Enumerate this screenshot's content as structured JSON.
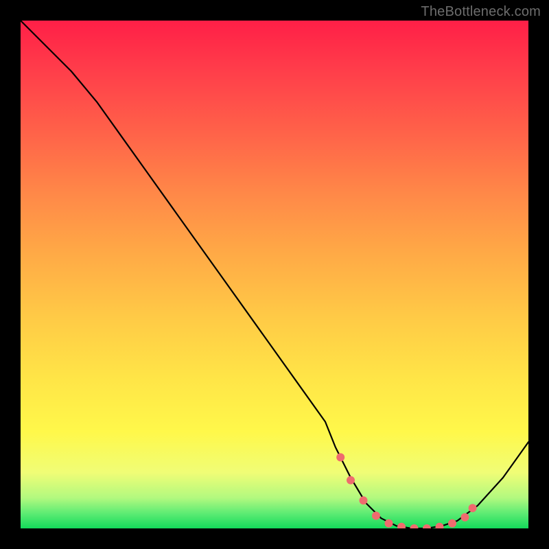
{
  "watermark": "TheBottleneck.com",
  "chart_data": {
    "type": "line",
    "title": "",
    "xlabel": "",
    "ylabel": "",
    "xlim": [
      0,
      100
    ],
    "ylim": [
      0,
      100
    ],
    "x": [
      0,
      5,
      10,
      15,
      20,
      25,
      30,
      35,
      40,
      45,
      50,
      55,
      60,
      62,
      65,
      68,
      71,
      74,
      77,
      80,
      83,
      86,
      90,
      95,
      100
    ],
    "values": [
      100,
      95,
      90,
      84,
      77,
      70,
      63,
      56,
      49,
      42,
      35,
      28,
      21,
      16,
      10,
      5,
      2,
      0.5,
      0,
      0,
      0.5,
      1.5,
      4.5,
      10,
      17
    ],
    "highlight": {
      "color": "#ef6b6e",
      "x": [
        63,
        65,
        67.5,
        70,
        72.5,
        75,
        77.5,
        80,
        82.5,
        85,
        87.5,
        89
      ],
      "values": [
        14,
        9.5,
        5.5,
        2.5,
        1,
        0.3,
        0,
        0,
        0.3,
        1,
        2.2,
        4
      ]
    }
  }
}
